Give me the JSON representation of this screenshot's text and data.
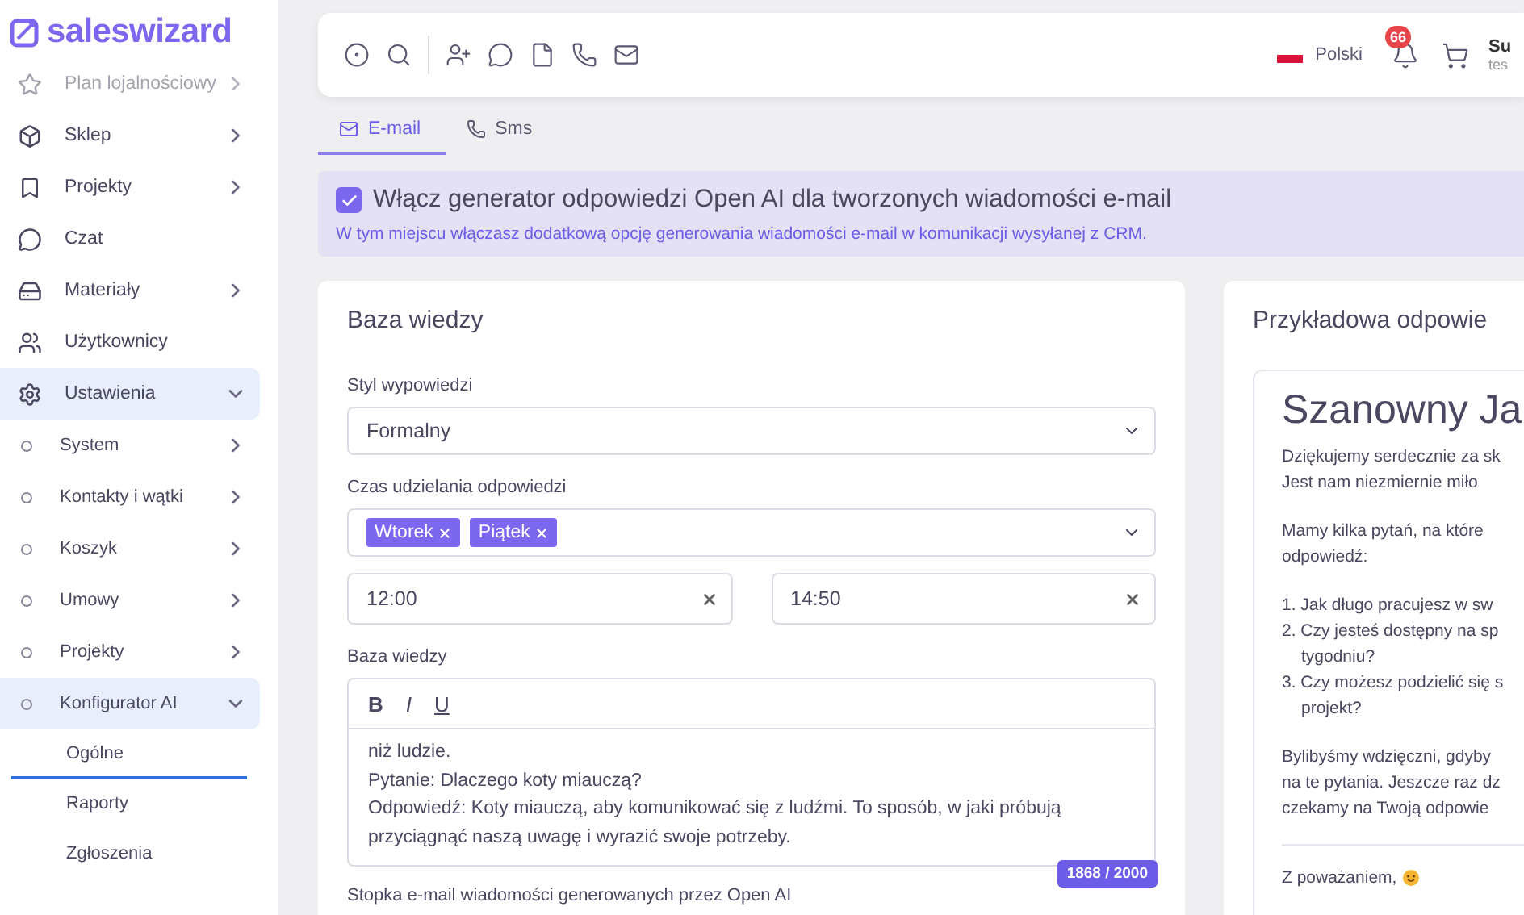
{
  "sidebar": {
    "logo": "saleswizard",
    "items": [
      {
        "label": "Plan lojalnościowy",
        "kind": "group",
        "selected": false,
        "disabled": true
      },
      {
        "label": "Sklep",
        "kind": "group",
        "selected": false,
        "disabled": false
      },
      {
        "label": "Projekty",
        "kind": "group",
        "selected": false,
        "disabled": false
      },
      {
        "label": "Czat",
        "kind": "link",
        "selected": false,
        "disabled": false
      },
      {
        "label": "Materiały",
        "kind": "group",
        "selected": false,
        "disabled": false
      },
      {
        "label": "Użytkownicy",
        "kind": "link",
        "selected": false,
        "disabled": false
      },
      {
        "label": "Ustawienia",
        "kind": "group",
        "expanded": true,
        "selected": true,
        "disabled": false,
        "children": [
          {
            "label": "System",
            "kind": "group",
            "selected": false
          },
          {
            "label": "Kontakty i wątki",
            "kind": "group",
            "selected": false
          },
          {
            "label": "Koszyk",
            "kind": "group",
            "selected": false
          },
          {
            "label": "Umowy",
            "kind": "group",
            "selected": false
          },
          {
            "label": "Projekty",
            "kind": "group",
            "selected": false
          },
          {
            "label": "Konfigurator AI",
            "kind": "group",
            "expanded": true,
            "selected": true,
            "children": [
              {
                "label": "Ogólne",
                "selected": true
              },
              {
                "label": "Raporty",
                "selected": false
              },
              {
                "label": "Zgłoszenia",
                "selected": false
              }
            ]
          }
        ]
      }
    ]
  },
  "header": {
    "tools": [
      {
        "kind": "target"
      },
      {
        "kind": "search"
      },
      {
        "kind": "divider"
      },
      {
        "kind": "user-plus"
      },
      {
        "kind": "chat"
      },
      {
        "kind": "file"
      },
      {
        "kind": "phone"
      },
      {
        "kind": "mail"
      }
    ],
    "language": "Polski",
    "notifications": "66",
    "user_name": "Su",
    "user_sub": "tes"
  },
  "tabs": [
    {
      "label": "E-mail",
      "selected": true
    },
    {
      "label": "Sms",
      "selected": false
    }
  ],
  "banner": {
    "checked": true,
    "title": "Włącz generator odpowiedzi Open AI dla tworzonych wiadomości e-mail",
    "description": "W tym miejscu włączasz dodatkową opcję generowania wiadomości e-mail w komunikacji wysyłanej z CRM."
  },
  "knowledge": {
    "title": "Baza wiedzy",
    "style_label": "Styl wypowiedzi",
    "style_value": "Formalny",
    "time_label": "Czas udzielania odpowiedzi",
    "days": [
      "Wtorek",
      "Piątek"
    ],
    "times": [
      "12:00",
      "14:50"
    ],
    "base_label": "Baza wiedzy",
    "format_buttons": [
      "B",
      "I",
      "U"
    ],
    "base_lines": [
      "niż ludzie.",
      "Pytanie: Dlaczego koty miauczą?",
      "Odpowiedź: Koty miauczą, aby komunikować się z ludźmi. To sposób, w jaki próbują przyciągnąć naszą uwagę i wyrazić swoje potrzeby."
    ],
    "counter": "1868 / 2000",
    "footer_label": "Stopka e-mail wiadomości generowanych przez Open AI"
  },
  "preview": {
    "title": "Przykładowa odpowie",
    "heading": "Szanowny Ja",
    "blocks": [
      {
        "kind": "paragraph",
        "lines": [
          "Dziękujemy serdecznie za sk",
          "Jest nam niezmiernie miło"
        ]
      },
      {
        "kind": "paragraph",
        "lines": [
          "Mamy kilka pytań, na które",
          "odpowiedź:"
        ]
      },
      {
        "kind": "list",
        "items": [
          [
            "1. Jak długo pracujesz w sw"
          ],
          [
            "2. Czy jesteś dostępny na sp",
            "tygodniu?"
          ],
          [
            "3. Czy możesz podzielić się s",
            "projekt?"
          ]
        ]
      },
      {
        "kind": "paragraph",
        "lines": [
          "Bylibyśmy wdzięczni, gdyby",
          "na te pytania. Jeszcze raz dz",
          "czekamy na Twoją odpowie"
        ]
      }
    ],
    "signature": "Z poważaniem,"
  }
}
